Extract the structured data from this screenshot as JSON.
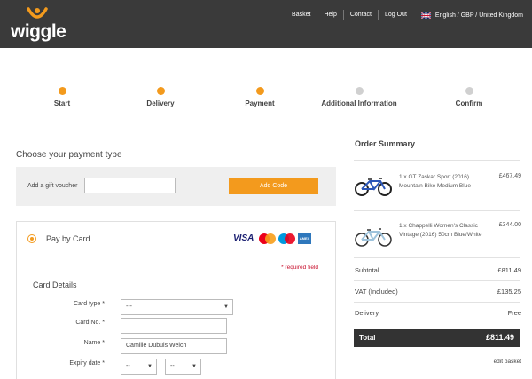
{
  "brand": {
    "name": "wiggle",
    "accent": "#f39a1d",
    "header_bg": "#3a3a3a"
  },
  "nav": {
    "items": [
      "Basket",
      "Help",
      "Contact",
      "Log Out"
    ],
    "region": "English / GBP / United Kingdom",
    "flag_icon": "uk-flag-icon"
  },
  "progress": {
    "steps": [
      {
        "label": "Start",
        "state": "complete"
      },
      {
        "label": "Delivery",
        "state": "complete"
      },
      {
        "label": "Payment",
        "state": "current"
      },
      {
        "label": "Additional Information",
        "state": "pending"
      },
      {
        "label": "Confirm",
        "state": "pending"
      }
    ]
  },
  "payment": {
    "title": "Choose your payment type",
    "gift_label": "Add a gift voucher",
    "gift_value": "",
    "add_code_label": "Add Code",
    "method_label": "Pay by Card",
    "card_logos": {
      "visa": "VISA",
      "mastercard": "mastercard-icon",
      "maestro": "maestro-icon",
      "amex": "AMEX"
    },
    "required_note": "* required field",
    "card_details_title": "Card Details",
    "fields": {
      "card_type": {
        "label": "Card type *",
        "value": "---"
      },
      "card_no": {
        "label": "Card No. *",
        "value": ""
      },
      "name": {
        "label": "Name *",
        "value": "Camille Dubuis Welch"
      },
      "expiry": {
        "label": "Expiry date *",
        "month": "--",
        "year": "--"
      }
    }
  },
  "summary": {
    "title": "Order Summary",
    "items": [
      {
        "desc": "1 x GT Zaskar Sport (2016) Mountain Bike Medium Blue",
        "price": "£467.49",
        "icon": "mountain-bike-icon"
      },
      {
        "desc": "1 x Chappelli Women's Classic Vintage (2016) 50cm Blue/White",
        "price": "£344.00",
        "icon": "city-bike-icon"
      }
    ],
    "subtotal_label": "Subtotal",
    "subtotal_value": "£811.49",
    "vat_label": "VAT (Included)",
    "vat_value": "£135.25",
    "delivery_label": "Delivery",
    "delivery_value": "Free",
    "total_label": "Total",
    "total_value": "£811.49",
    "edit_label": "edit basket"
  }
}
